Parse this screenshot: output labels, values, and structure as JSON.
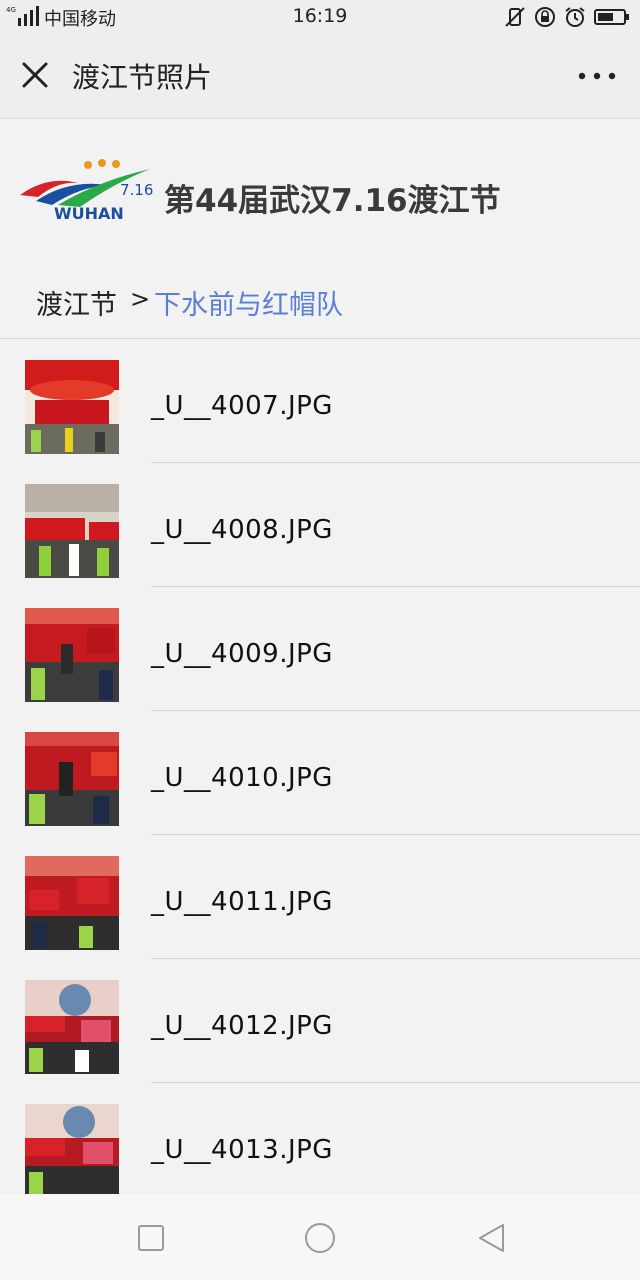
{
  "status_bar": {
    "network": "4G",
    "carrier": "中国移动",
    "time": "16:19"
  },
  "header": {
    "title": "渡江节照片"
  },
  "banner": {
    "logo_text": "WUHAN",
    "logo_number": "7.16",
    "title": "第44届武汉7.16渡江节"
  },
  "breadcrumb": {
    "root": "渡江节",
    "separator": ">",
    "current": "下水前与红帽队"
  },
  "files": [
    {
      "name": "_U__4007.JPG"
    },
    {
      "name": "_U__4008.JPG"
    },
    {
      "name": "_U__4009.JPG"
    },
    {
      "name": "_U__4010.JPG"
    },
    {
      "name": "_U__4011.JPG"
    },
    {
      "name": "_U__4012.JPG"
    },
    {
      "name": "_U__4013.JPG"
    }
  ],
  "colors": {
    "link_blue": "#5b7fd6",
    "thumb_red": "#c8161d"
  }
}
